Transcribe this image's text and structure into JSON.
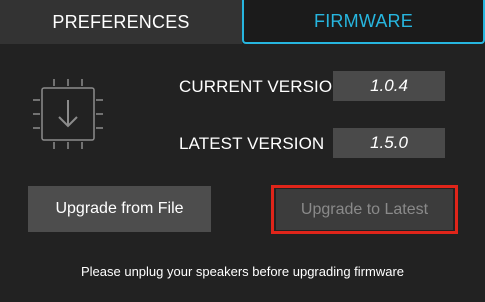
{
  "tabs": [
    {
      "label": "PREFERENCES",
      "active": false
    },
    {
      "label": "FIRMWARE",
      "active": true
    }
  ],
  "firmware": {
    "icon": "chip-download-icon",
    "current_version_label": "CURRENT VERSION",
    "current_version_value": "1.0.4",
    "latest_version_label": "LATEST VERSION",
    "latest_version_value": "1.5.0",
    "upgrade_from_file_label": "Upgrade from File",
    "upgrade_to_latest_label": "Upgrade to Latest",
    "upgrade_to_latest_enabled": false,
    "notice": "Please unplug your speakers before upgrading firmware"
  },
  "colors": {
    "accent": "#27b6df",
    "highlight": "#e0251a",
    "background": "#222222"
  }
}
